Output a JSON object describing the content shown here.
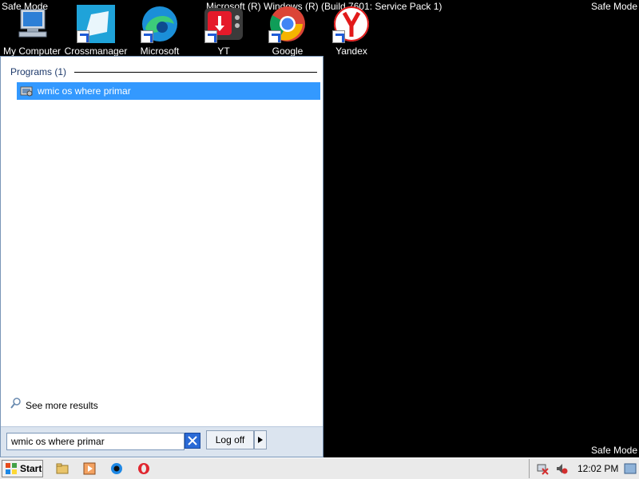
{
  "desktop": {
    "safe_mode_label": "Safe Mode",
    "build_text": "Microsoft (R) Windows (R) (Build 7601: Service Pack 1)",
    "icons": [
      {
        "label": "My Computer"
      },
      {
        "label": "Crossmanager"
      },
      {
        "label": "Microsoft"
      },
      {
        "label": "YT"
      },
      {
        "label": "Google"
      },
      {
        "label": "Yandex"
      }
    ]
  },
  "start_menu": {
    "programs_header": "Programs (1)",
    "result_item": "wmic os where primar",
    "see_more": "See more results",
    "search_value": "wmic os where primar",
    "logoff_label": "Log off"
  },
  "taskbar": {
    "start_label": "Start",
    "clock": "12:02 PM"
  },
  "colors": {
    "desktop_bg": "#000000",
    "selection": "#3399ff",
    "menu_border": "#7a96b8"
  }
}
